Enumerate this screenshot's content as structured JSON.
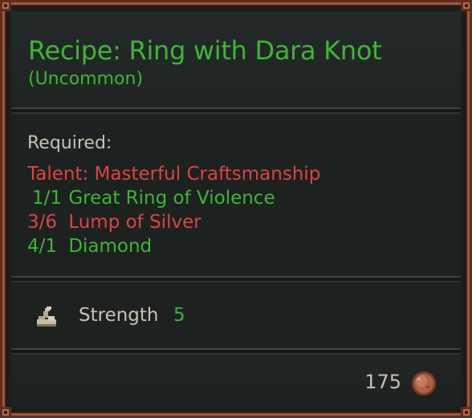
{
  "tooltip": {
    "title": "Recipe: Ring with Dara Knot",
    "rarity": "(Uncommon)",
    "required_label": "Required:",
    "requirements": [
      {
        "qty": "",
        "text": "Talent: Masterful Craftsmanship",
        "met": false,
        "color": "#d84545"
      },
      {
        "qty": "1/1",
        "text": "Great Ring of Violence",
        "met": true,
        "color": "#3fb437"
      },
      {
        "qty": "3/6",
        "text": "Lump of Silver",
        "met": false,
        "color": "#d84545"
      },
      {
        "qty": "4/1",
        "text": "Diamond",
        "met": true,
        "color": "#3fb437"
      }
    ],
    "stat": {
      "icon": "flexed-arm-icon",
      "label": "Strength",
      "value": "5"
    },
    "price": {
      "value": "175",
      "icon": "copper-coin-icon"
    }
  },
  "colors": {
    "accent_green": "#3fb437",
    "warning_red": "#d84545",
    "frame_copper": "#a4573f",
    "panel_bg": "#1d2120"
  }
}
